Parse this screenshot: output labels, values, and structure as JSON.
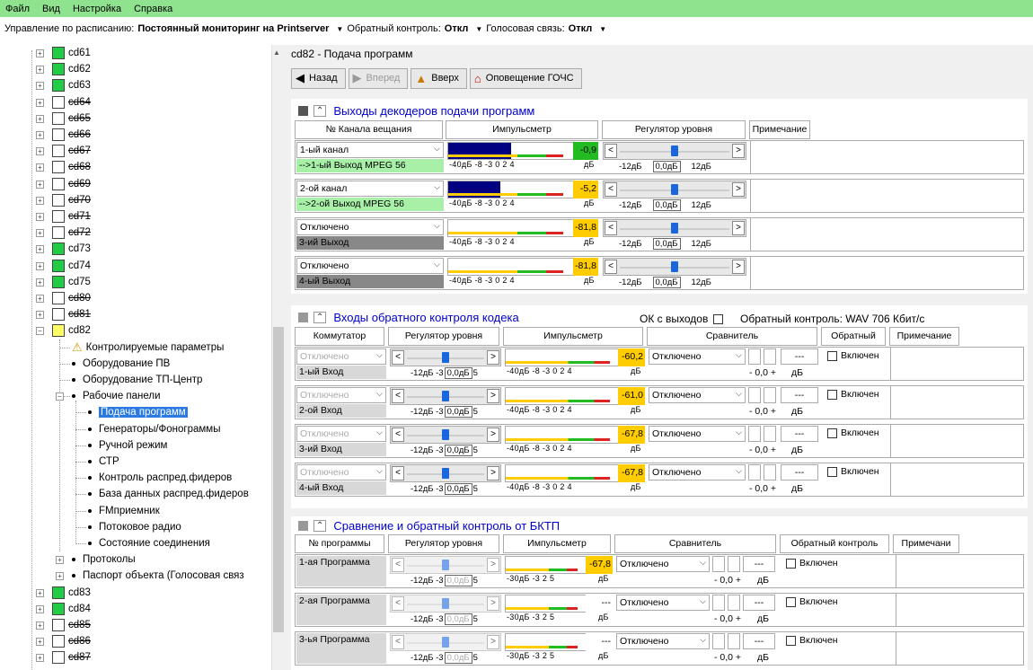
{
  "menu": [
    "Файл",
    "Вид",
    "Настройка",
    "Справка"
  ],
  "schedbar": {
    "sched_label": "Управление по расписанию:",
    "sched_value": "Постоянный мониторинг на Printserver",
    "back_label": "Обратный контроль:",
    "back_value": "Откл",
    "voice_label": "Голосовая связь:",
    "voice_value": "Откл"
  },
  "tree": {
    "top_nodes": [
      {
        "label": "cd61",
        "state": "green",
        "struck": false
      },
      {
        "label": "cd62",
        "state": "green",
        "struck": false
      },
      {
        "label": "cd63",
        "state": "green",
        "struck": false
      },
      {
        "label": "cd64",
        "state": "empty",
        "struck": true
      },
      {
        "label": "cd65",
        "state": "empty",
        "struck": true
      },
      {
        "label": "cd66",
        "state": "empty",
        "struck": true
      },
      {
        "label": "cd67",
        "state": "empty",
        "struck": true
      },
      {
        "label": "cd68",
        "state": "empty",
        "struck": true
      },
      {
        "label": "cd69",
        "state": "empty",
        "struck": true
      },
      {
        "label": "cd70",
        "state": "empty",
        "struck": true
      },
      {
        "label": "cd71",
        "state": "empty",
        "struck": true
      },
      {
        "label": "cd72",
        "state": "empty",
        "struck": true
      },
      {
        "label": "cd73",
        "state": "green",
        "struck": false
      },
      {
        "label": "cd74",
        "state": "green",
        "struck": false
      },
      {
        "label": "cd75",
        "state": "green",
        "struck": false
      },
      {
        "label": "cd80",
        "state": "empty",
        "struck": true
      },
      {
        "label": "cd81",
        "state": "empty",
        "struck": true
      },
      {
        "label": "cd82",
        "state": "yellow",
        "struck": false
      }
    ],
    "cd82_children": [
      "Контролируемые параметры",
      "Оборудование ПВ",
      "Оборудование ТП-Центр",
      "Рабочие панели"
    ],
    "panels": [
      "Подача программ",
      "Генераторы/Фонограммы",
      "Ручной режим",
      "СТР",
      "Контроль распред.фидеров",
      "База данных распред.фидеров",
      "FMприемник",
      "Потоковое радио",
      "Состояние соединения"
    ],
    "after": [
      "Протоколы",
      "Паспорт объекта (Голосовая связ"
    ],
    "bottom_nodes": [
      {
        "label": "cd83",
        "state": "green",
        "struck": false
      },
      {
        "label": "cd84",
        "state": "green",
        "struck": false
      },
      {
        "label": "cd85",
        "state": "empty",
        "struck": true
      },
      {
        "label": "cd86",
        "state": "empty",
        "struck": true
      },
      {
        "label": "cd87",
        "state": "empty",
        "struck": true
      }
    ]
  },
  "main": {
    "path": "cd82 - Подача программ",
    "toolbar": {
      "back": "Назад",
      "forward": "Вперед",
      "up": "Вверх",
      "alert": "Оповещение ГОЧС"
    }
  },
  "sec1": {
    "title": "Выходы декодеров подачи программ",
    "cols": [
      "№ Канала вещания",
      "Импульсметр",
      "Регулятор уровня",
      "Примечание"
    ],
    "rows": [
      {
        "channel": "1-ый канал",
        "output": "-->1-ый Выход  MPEG 56",
        "value": "-0,9",
        "fill": 0.55,
        "valcolor": "#22bb22",
        "outcolor": "#a8f0a8",
        "slider": 0.5,
        "level": "0,0дБ"
      },
      {
        "channel": "2-ой канал",
        "output": "-->2-ой Выход  MPEG 56",
        "value": "-5,2",
        "fill": 0.45,
        "valcolor": "#ffcc00",
        "outcolor": "#a8f0a8",
        "slider": 0.5,
        "level": "0,0дБ"
      },
      {
        "channel": "Отключено",
        "output": "3-ий Выход",
        "value": "-81,8",
        "fill": 0,
        "valcolor": "#ffcc00",
        "outcolor": "#888888",
        "slider": 0.5,
        "level": "0,0дБ"
      },
      {
        "channel": "Отключено",
        "output": "4-ый Выход",
        "value": "-81,8",
        "fill": 0,
        "valcolor": "#ffcc00",
        "outcolor": "#888888",
        "slider": 0.5,
        "level": "0,0дБ"
      }
    ],
    "meter_scale": "-40дБ  -8  -3   0  2  4",
    "db": "дБ",
    "level_min": "-12дБ",
    "level_max": "12дБ"
  },
  "sec2": {
    "title": "Входы обратного контроля кодека",
    "ok_label": "ОК с выходов",
    "back_label": "Обратный контроль: WAV 706 Кбит/с",
    "cols": [
      "Коммутатор",
      "Регулятор уровня",
      "Импульсметр",
      "Сравнитель",
      "Обратный",
      "Примечание"
    ],
    "rows": [
      {
        "switch": "Отключено",
        "input": "1-ый Вход",
        "value": "-60,2",
        "compare": "Отключено",
        "check": "Включен"
      },
      {
        "switch": "Отключено",
        "input": "2-ой Вход",
        "value": "-61,0",
        "compare": "Отключено",
        "check": "Включен"
      },
      {
        "switch": "Отключено",
        "input": "3-ий Вход",
        "value": "-67,8",
        "compare": "Отключено",
        "check": "Включен"
      },
      {
        "switch": "Отключено",
        "input": "4-ый Вход",
        "value": "-67,8",
        "compare": "Отключено",
        "check": "Включен"
      }
    ],
    "level_scale": "-12дБ -3",
    "level": "0,0дБ",
    "level_end": "5",
    "meter_scale": "-40дБ  -8  -3   0  2  4",
    "db": "дБ",
    "cmp_scale": "- 0,0 +",
    "dash": "---"
  },
  "sec3": {
    "title": "Сравнение и обратный контроль от БКТП",
    "cols": [
      "№ программы",
      "Регулятор уровня",
      "Импульсметр",
      "Сравнитель",
      "Обратный контроль",
      "Примечани"
    ],
    "rows": [
      {
        "program": "1-ая Программа",
        "value": "-67,8",
        "compare": "Отключено",
        "check": "Включен"
      },
      {
        "program": "2-ая Программа",
        "value": "---",
        "compare": "Отключено",
        "check": "Включен"
      },
      {
        "program": "3-ья Программа",
        "value": "---",
        "compare": "Отключено",
        "check": "Включен"
      }
    ],
    "level_scale": "-12дБ -3",
    "level": "0,0дБ",
    "level_end": "5",
    "meter_scale": "-30дБ  -3   2  5",
    "db": "дБ",
    "cmp_scale": "- 0,0 +",
    "dash": "---"
  }
}
